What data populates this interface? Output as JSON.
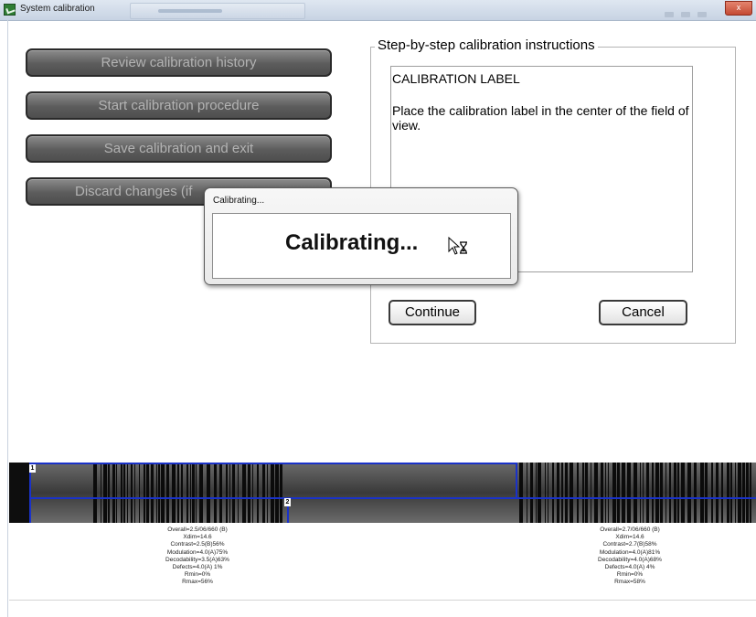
{
  "window": {
    "title": "System calibration",
    "close_label": "x"
  },
  "buttons": [
    "Review calibration history",
    "Start calibration procedure",
    "Save calibration and exit",
    "Discard changes (if"
  ],
  "instructions": {
    "legend": "Step-by-step calibration instructions",
    "title": "CALIBRATION LABEL",
    "body": "Place the calibration label in the center of the field of view.",
    "continue_label": "Continue",
    "cancel_label": "Cancel"
  },
  "dialog": {
    "title": "Calibrating...",
    "message": "Calibrating..."
  },
  "barcode": {
    "roi_labels": [
      "1",
      "2"
    ],
    "left_stats": [
      "Overall=2.5/06/660 (B)",
      "Xdim=14.6",
      "Contrast=2.5(B)56%",
      "Modulation=4.0(A)75%",
      "Decodability=3.5(A)63%",
      "Defects=4.0(A) 1%",
      "Rmin=0%",
      "Rmax=56%"
    ],
    "right_stats": [
      "Overall=2.7/06/660 (B)",
      "Xdim=14.6",
      "Contrast=2.7(B)58%",
      "Modulation=4.0(A)81%",
      "Decodability=4.0(A)68%",
      "Defects=4.0(A) 4%",
      "Rmin=0%",
      "Rmax=58%"
    ]
  },
  "colors": {
    "roi": "#1a32c9",
    "button_dark": "#5c5c5c",
    "button_text": "#b3b3b3"
  },
  "icons": {
    "app": "calibration-app-icon",
    "cursor": "hourglass-cursor-icon"
  }
}
